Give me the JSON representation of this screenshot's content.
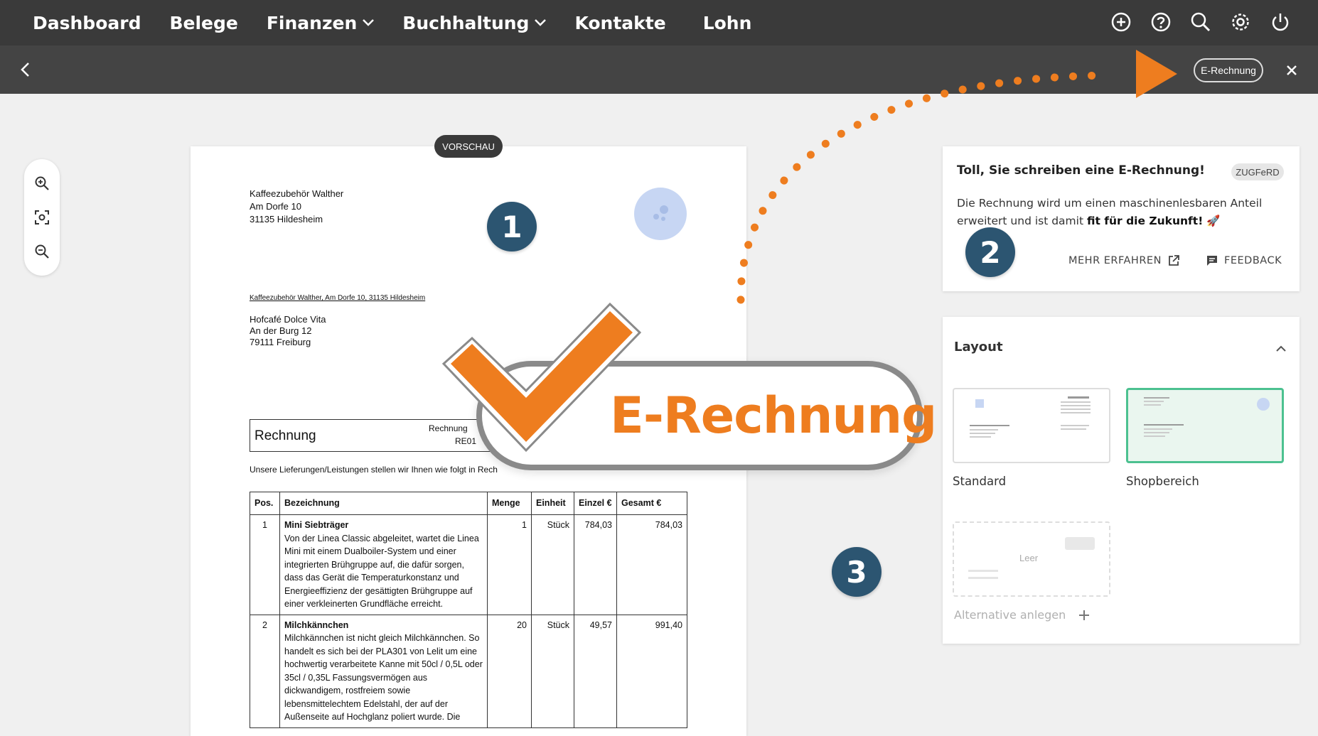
{
  "nav": {
    "items": [
      {
        "label": "Dashboard"
      },
      {
        "label": "Belege"
      },
      {
        "label": "Finanzen",
        "dropdown": true
      },
      {
        "label": "Buchhaltung",
        "dropdown": true
      },
      {
        "label": "Kontakte"
      },
      {
        "label": "Lohn"
      }
    ],
    "icons": [
      "plus-circle-icon",
      "help-icon",
      "search-icon",
      "gear-icon",
      "power-icon"
    ]
  },
  "subbar": {
    "pill_label": "E-Rechnung"
  },
  "preview": {
    "badge": "VORSCHAU",
    "sender_lines": [
      "Kaffeezubehör Walther",
      "Am Dorfe 10",
      "31135 Hildesheim"
    ],
    "return_line": "Kaffeezubehör Walther, Am Dorfe 10, 31135 Hildesheim",
    "recipient_lines": [
      "Hofcafé Dolce Vita",
      "An der Burg 12",
      "79111 Freiburg"
    ],
    "doc_title": "Rechnung",
    "number_label": "Rechnung",
    "number_value": "RE01",
    "intro": "Unsere Lieferungen/Leistungen stellen wir Ihnen wie folgt in Rech",
    "columns": [
      "Pos.",
      "Bezeichnung",
      "Menge",
      "Einheit",
      "Einzel €",
      "Gesamt €"
    ],
    "rows": [
      {
        "pos": "1",
        "name": "Mini Siebträger",
        "desc": "Von der Linea Classic abgeleitet, wartet die Linea Mini mit einem Dualboiler-System und einer integrierten Brühgruppe auf, die dafür sorgen, dass das Gerät die Temperaturkonstanz und Energieeffizienz der gesättigten Brühgruppe auf einer verkleinerten Grundfläche erreicht.",
        "qty": "1",
        "unit": "Stück",
        "price": "784,03",
        "total": "784,03"
      },
      {
        "pos": "2",
        "name": "Milchkännchen",
        "desc": "Milchkännchen ist nicht gleich Milchkännchen. So handelt es sich bei der PLA301 von Lelit um eine hochwertig verarbeitete Kanne mit 50cl / 0,5L oder 35cl / 0,35L Fassungsvermögen aus dickwandigem, rostfreiem sowie lebensmittelechtem Edelstahl, der auf der Außenseite auf Hochglanz poliert wurde. Die",
        "qty": "20",
        "unit": "Stück",
        "price": "49,57",
        "total": "991,40"
      }
    ]
  },
  "info_card": {
    "title": "Toll, Sie schreiben eine E-Rechnung!",
    "tag": "ZUGFeRD",
    "body_prefix": "Die Rechnung wird um einen maschinenlesbaren Anteil erweitert und ist damit ",
    "body_bold": "fit für die Zukunft!",
    "body_suffix": " 🚀",
    "more_label": "MEHR ERFAHREN",
    "feedback_label": "FEEDBACK"
  },
  "layout_card": {
    "title": "Layout",
    "options": [
      {
        "label": "Standard",
        "selected": false
      },
      {
        "label": "Shopbereich",
        "selected": true
      }
    ],
    "empty_label": "Leer",
    "alt_label": "Alternative anlegen"
  },
  "overlay": {
    "headline": "E-Rechnung",
    "badges": [
      "1",
      "2",
      "3"
    ],
    "accent_color": "#ee7d1f",
    "badge_color": "#2c5571"
  }
}
